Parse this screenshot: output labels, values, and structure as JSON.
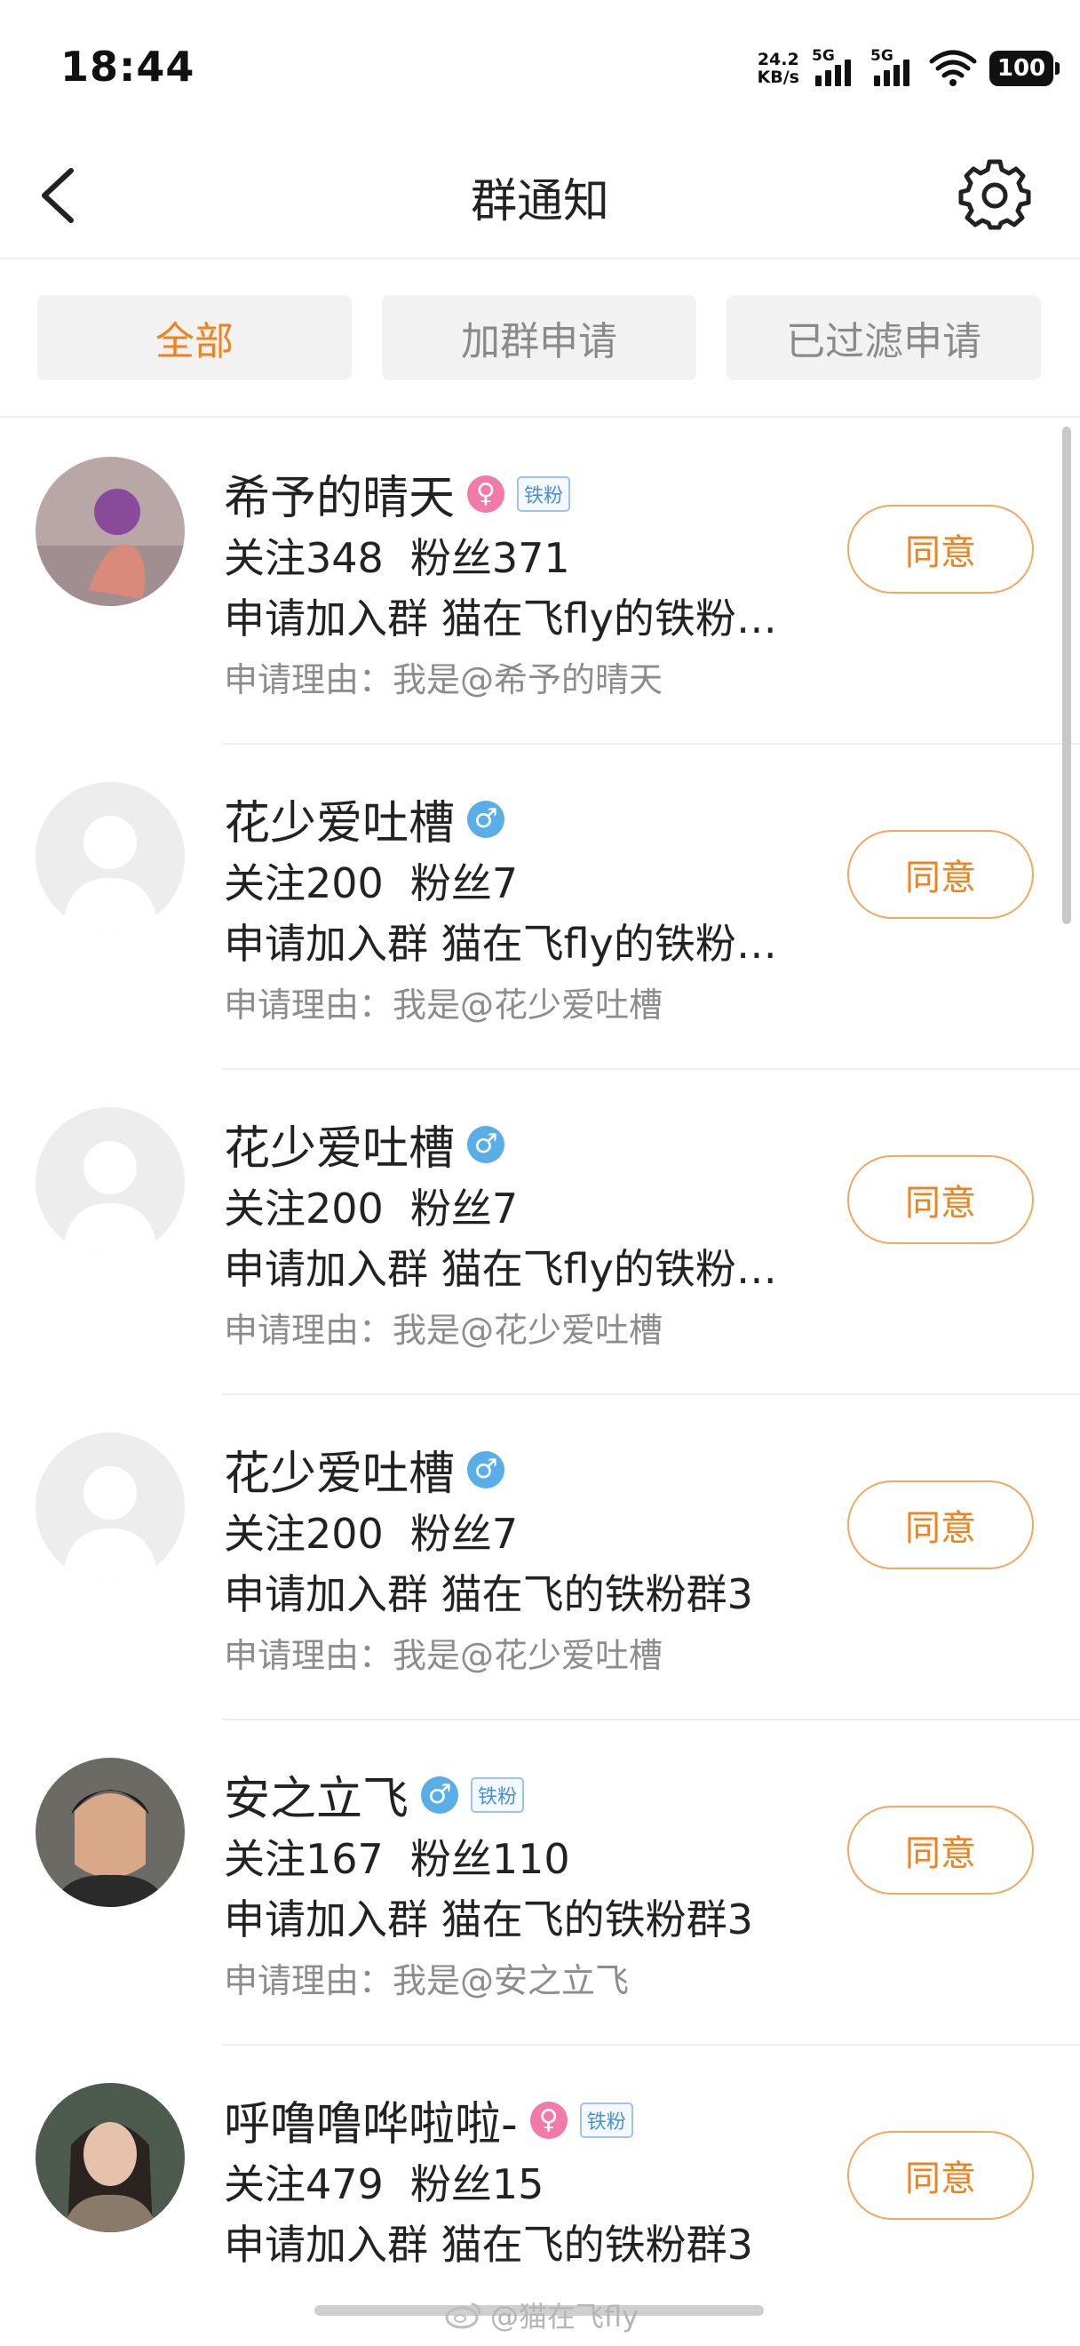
{
  "status": {
    "time": "18:44",
    "net_speed_value": "24.2",
    "net_speed_unit": "KB/s",
    "sim1": "5G",
    "sim2": "5G",
    "battery": "100"
  },
  "header": {
    "title": "群通知"
  },
  "tabs": [
    {
      "label": "全部",
      "active": true
    },
    {
      "label": "加群申请",
      "active": false
    },
    {
      "label": "已过滤申请",
      "active": false
    }
  ],
  "requests": [
    {
      "name": "希予的晴天",
      "gender": "female",
      "badge": "铁粉",
      "following": "关注348",
      "fans": "粉丝371",
      "group": "申请加入群 猫在飞fly的铁粉…",
      "reason": "申请理由：我是@希予的晴天",
      "action": "同意"
    },
    {
      "name": "花少爱吐槽",
      "gender": "male",
      "badge": "",
      "following": "关注200",
      "fans": "粉丝7",
      "group": "申请加入群 猫在飞fly的铁粉…",
      "reason": "申请理由：我是@花少爱吐槽",
      "action": "同意"
    },
    {
      "name": "花少爱吐槽",
      "gender": "male",
      "badge": "",
      "following": "关注200",
      "fans": "粉丝7",
      "group": "申请加入群 猫在飞fly的铁粉…",
      "reason": "申请理由：我是@花少爱吐槽",
      "action": "同意"
    },
    {
      "name": "花少爱吐槽",
      "gender": "male",
      "badge": "",
      "following": "关注200",
      "fans": "粉丝7",
      "group": "申请加入群 猫在飞的铁粉群3",
      "reason": "申请理由：我是@花少爱吐槽",
      "action": "同意"
    },
    {
      "name": "安之立飞",
      "gender": "male",
      "badge": "铁粉",
      "following": "关注167",
      "fans": "粉丝110",
      "group": "申请加入群 猫在飞的铁粉群3",
      "reason": "申请理由：我是@安之立飞",
      "action": "同意"
    },
    {
      "name": "呼噜噜哗啦啦-",
      "gender": "female",
      "badge": "铁粉",
      "following": "关注479",
      "fans": "粉丝15",
      "group": "申请加入群 猫在飞的铁粉群3",
      "reason": "",
      "action": "同意"
    }
  ],
  "gender_symbols": {
    "male": "♂",
    "female": "♀"
  },
  "watermark": "@猫在飞fly",
  "colors": {
    "accent": "#f0821e",
    "male": "#5aaee8",
    "female": "#f27aa8",
    "badge": "#4a90d9"
  }
}
